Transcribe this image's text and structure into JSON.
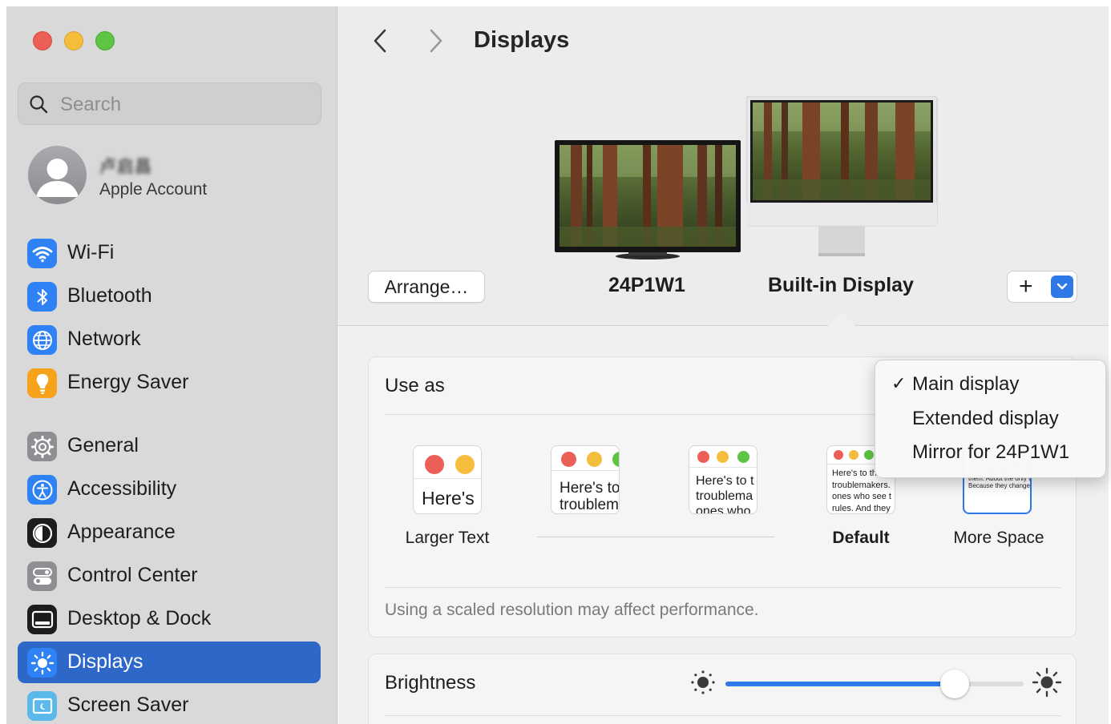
{
  "sidebar": {
    "search_placeholder": "Search",
    "account": {
      "name": "卢启昌",
      "subtitle": "Apple Account"
    },
    "items": [
      {
        "label": "Wi-Fi",
        "icon": "wifi-icon",
        "color": "#2f82f5"
      },
      {
        "label": "Bluetooth",
        "icon": "bluetooth-icon",
        "color": "#2f82f5"
      },
      {
        "label": "Network",
        "icon": "globe-icon",
        "color": "#2f82f5"
      },
      {
        "label": "Energy Saver",
        "icon": "lightbulb-icon",
        "color": "#f7a21b"
      },
      {
        "label": "General",
        "icon": "gear-icon",
        "color": "#8e8e93"
      },
      {
        "label": "Accessibility",
        "icon": "accessibility-icon",
        "color": "#2f82f5"
      },
      {
        "label": "Appearance",
        "icon": "appearance-icon",
        "color": "#1d1d1f"
      },
      {
        "label": "Control Center",
        "icon": "control-center-icon",
        "color": "#8e8e93"
      },
      {
        "label": "Desktop & Dock",
        "icon": "desktop-dock-icon",
        "color": "#1d1d1f"
      },
      {
        "label": "Displays",
        "icon": "sun-icon",
        "color": "#2f82f5",
        "selected": true
      },
      {
        "label": "Screen Saver",
        "icon": "screen-saver-icon",
        "color": "#5ab9ea"
      }
    ]
  },
  "toolbar": {
    "title": "Displays"
  },
  "displays": {
    "arrange_label": "Arrange…",
    "external_name": "24P1W1",
    "builtin_name": "Built-in Display",
    "add_symbol": "+"
  },
  "use_as": {
    "title": "Use as",
    "menu_options": [
      {
        "label": "Main display",
        "checked": true
      },
      {
        "label": "Extended display",
        "checked": false
      },
      {
        "label": "Mirror for 24P1W1",
        "checked": false
      }
    ],
    "check_mark": "✓"
  },
  "resolution": {
    "options": [
      {
        "label": "Larger Text",
        "preview": "Here's"
      },
      {
        "label": "",
        "preview": "Here's to\ntroublem"
      },
      {
        "label": "",
        "preview": "Here's to t\ntroublema\nones who"
      },
      {
        "label": "Default",
        "preview": "Here's to th\ntroublemakers.\nones who see t\nrules. And they"
      },
      {
        "label": "More Space",
        "preview": "ones who see things di\nrules. And they have no\ncan quote them, disagr\nthem. About the only th\nBecause they change t"
      }
    ],
    "note": "Using a scaled resolution may affect performance."
  },
  "brightness": {
    "title": "Brightness",
    "level_percent": 77
  },
  "colors": {
    "accent": "#2f78e8",
    "sidebar_selected": "#2d68c9"
  }
}
